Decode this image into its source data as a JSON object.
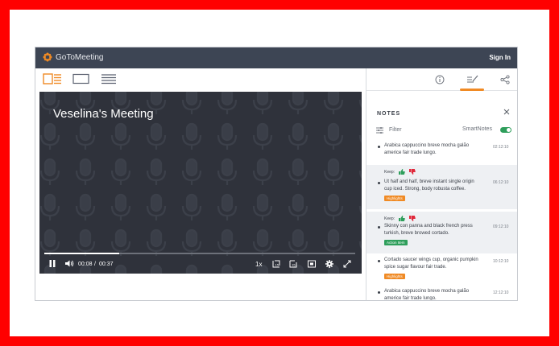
{
  "app": {
    "brand": "GoToMeeting",
    "sign_in": "Sign In"
  },
  "video": {
    "title": "Veselina's Meeting",
    "time_current": "00:08",
    "time_separator": "/",
    "time_total": "00:37",
    "speed": "1x",
    "progress": 0.24
  },
  "panel": {
    "header": "NOTES",
    "filter_label": "Filter",
    "smartnotes_label": "SmartNotes",
    "keep_label": "Keep:",
    "notes": [
      {
        "text": "Arabica cappuccino breve mocha galão americe fair trade lungo.",
        "time": "02:12:10"
      },
      {
        "text": "Ut half and half, breve instant single origin cup iced. Strong, body robusta coffee.",
        "time": "06:12:10",
        "tag": "Highlights"
      },
      {
        "text": "Skinny con panna and black french press turkish, breve browed cortado.",
        "time": "09:12:10",
        "tag": "Action Item"
      },
      {
        "text": "Cortado saucer wings cup, organic pumpkin spice sugar flavour fair trade.",
        "time": "10:12:10",
        "tag": "Highlights"
      },
      {
        "text": "Arabica cappuccino breve mocha galão americe fair trade lungo.",
        "time": "12:12:10"
      }
    ]
  },
  "colors": {
    "topbar": "#3d4554",
    "accent": "#f08a24",
    "green": "#2e9e5b",
    "video_bg": "#2f323b",
    "frame": "#ff0000"
  }
}
